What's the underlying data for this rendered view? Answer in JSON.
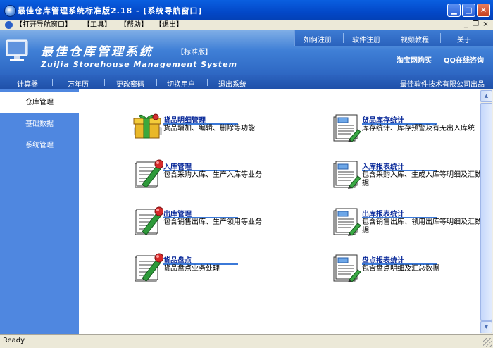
{
  "window": {
    "title": "最佳仓库管理系统标准版2.18 - [系统导航窗口]",
    "controls": [
      "minimize",
      "maximize",
      "close"
    ]
  },
  "menubar": {
    "items": [
      "【打开导航窗口】",
      "【工具】",
      "【帮助】",
      "【退出】"
    ]
  },
  "banner": {
    "brand_cn": "最佳仓库管理系统",
    "edition": "【标准版】",
    "brand_en": "ZuiJia Storehouse Management System",
    "top_links": [
      "如何注册",
      "软件注册",
      "视频教程",
      "关于"
    ],
    "buy_link": "淘宝网购买",
    "qq_link": "QQ在线咨询"
  },
  "navbar": {
    "items": [
      "计算器",
      "万年历",
      "更改密码",
      "切换用户",
      "退出系统"
    ],
    "company": "最佳软件技术有限公司出品"
  },
  "sidebar": {
    "items": [
      {
        "label": "仓库管理",
        "active": true
      },
      {
        "label": "基础数据",
        "active": false
      },
      {
        "label": "系统管理",
        "active": false
      }
    ]
  },
  "modules": [
    {
      "title": "货品明细管理",
      "desc": "货品增加、编辑、删除等功能",
      "icon": "gift-box-icon"
    },
    {
      "title": "货品库存统计",
      "desc": "库存统计、库存预警及有无出入库统",
      "icon": "report-document-icon"
    },
    {
      "title": "入库管理",
      "desc": "包含采购入库、生产入库等业务",
      "icon": "document-pen-icon"
    },
    {
      "title": "入库报表统计",
      "desc": "包含采购入库、生成入库等明细及汇数据",
      "icon": "report-document-icon"
    },
    {
      "title": "出库管理",
      "desc": "包含销售出库、生产领用等业务",
      "icon": "document-pen-icon"
    },
    {
      "title": "出库报表统计",
      "desc": "包含销售出库、领用出库等明细及汇数据",
      "icon": "report-document-icon"
    },
    {
      "title": "货品盘点",
      "desc": "货品盘点业务处理",
      "icon": "document-pen-icon"
    },
    {
      "title": "盘点报表统计",
      "desc": "包含盘点明细及汇总数据",
      "icon": "report-document-icon"
    }
  ],
  "status": {
    "text": "Ready"
  },
  "colors": {
    "titlebar": "#0a5fe0",
    "banner": "#3f7fd6",
    "navbar": "#2c63bf",
    "sidebar": "#4f87e0",
    "link": "#0a2a9a"
  }
}
